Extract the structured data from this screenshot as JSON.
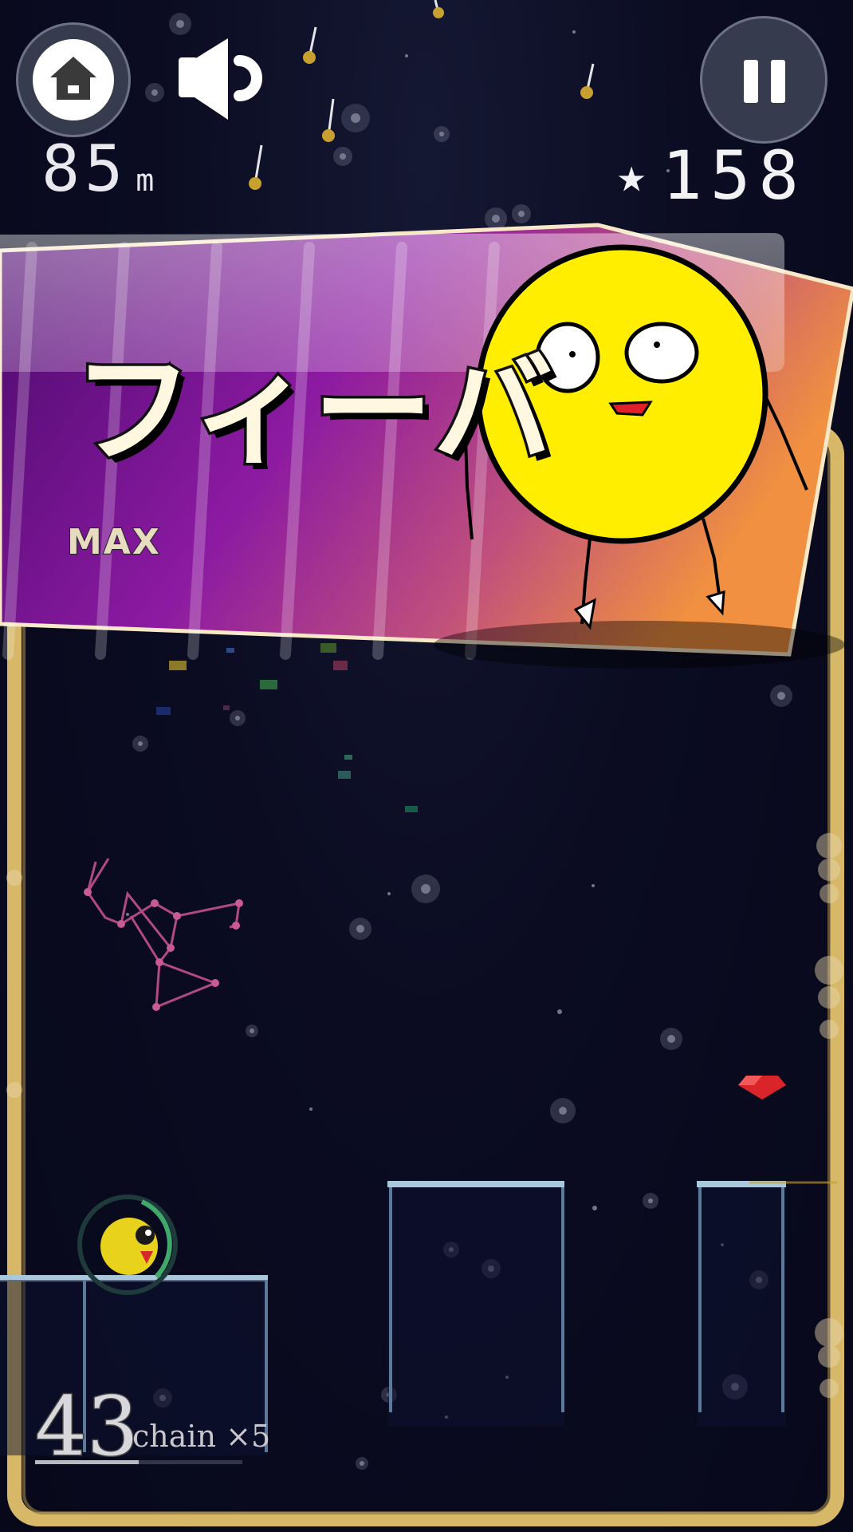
{
  "hud": {
    "distance_value": "85",
    "distance_unit": "m",
    "star_count": "158",
    "home_icon": "home-icon",
    "sound_icon": "speaker-icon",
    "pause_icon": "pause-icon"
  },
  "fever": {
    "title": "フィーバ",
    "level": "MAX"
  },
  "combo": {
    "count": "43",
    "chain_label": "chain ×5",
    "progress": 0.5
  },
  "colors": {
    "frame_gold": "#d9b969",
    "banner_purple": "#8a1aa0",
    "banner_orange": "#e88a3a",
    "character_yellow": "#ffee00",
    "gem_red": "#d9252a",
    "constellation_pink": "#c2508c"
  },
  "icons": [
    "home-icon",
    "speaker-icon",
    "pause-icon",
    "star-icon",
    "ruby-gem-icon",
    "constellation-icon"
  ]
}
